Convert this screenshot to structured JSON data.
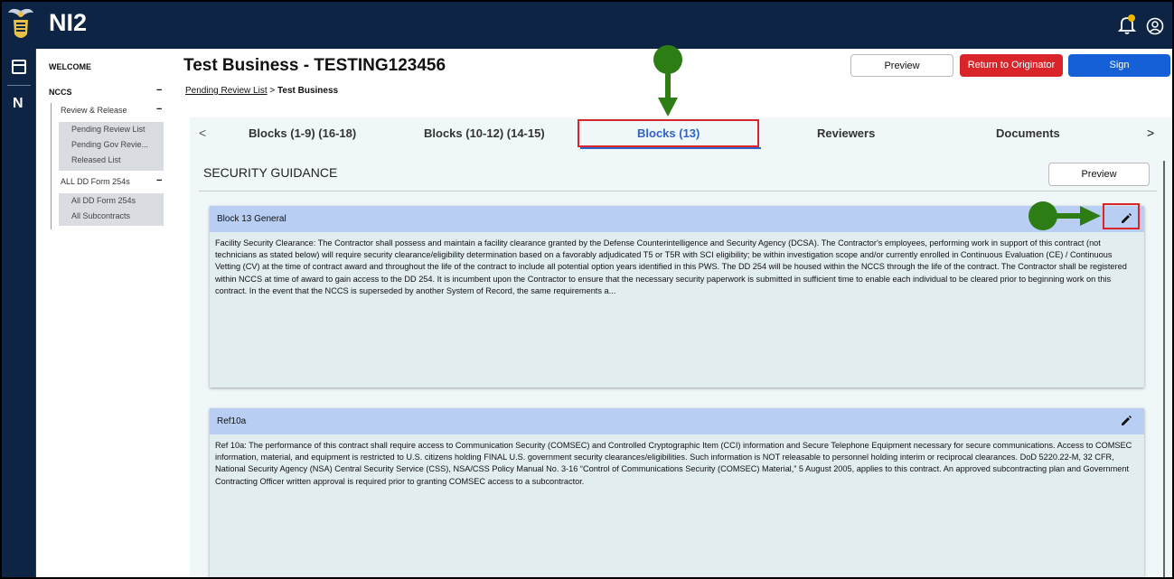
{
  "app": {
    "brand": "NI2"
  },
  "rail": {
    "letter": "N"
  },
  "nav": {
    "welcome": "WELCOME",
    "nccs": "NCCS",
    "review_release": "Review & Release",
    "review_items": [
      "Pending Review List",
      "Pending Gov Revie...",
      "Released List"
    ],
    "all_forms": "ALL DD Form 254s",
    "all_items": [
      "All DD Form 254s",
      "All Subcontracts"
    ]
  },
  "header": {
    "title": "Test Business - TESTING123456",
    "breadcrumb_link": "Pending Review List",
    "breadcrumb_sep": " > ",
    "breadcrumb_current": "Test Business",
    "preview_label": "Preview",
    "return_label": "Return to Originator",
    "sign_label": "Sign"
  },
  "tabs": {
    "items": [
      "Blocks (1-9) (16-18)",
      "Blocks (10-12) (14-15)",
      "Blocks (13)",
      "Reviewers",
      "Documents"
    ],
    "active_index": 2,
    "prev_arrow": "<",
    "next_arrow": ">"
  },
  "section": {
    "title": "SECURITY GUIDANCE",
    "preview_label": "Preview"
  },
  "cards": [
    {
      "title": "Block 13 General",
      "body": "Facility Security Clearance: The Contractor shall possess and maintain a facility clearance granted by the Defense Counterintelligence and Security Agency (DCSA). The Contractor's employees, performing work in support of this contract (not technicians as stated below) will require security clearance/eligibility determination based on a favorably adjudicated T5 or T5R with SCI eligibility; be within investigation scope and/or currently enrolled in Continuous Evaluation (CE) / Continuous Vetting (CV) at the time of contract award and throughout the life of the contract to include all potential option years identified in this PWS. The DD 254 will be housed within the NCCS through the life of the contract. The Contractor shall be registered within NCCS at time of award to gain access to the DD 254. It is incumbent upon the Contractor to ensure that the necessary security paperwork is submitted in sufficient time to enable each individual to be cleared prior to beginning work on this contract. In the event that the NCCS is superseded by another System of Record, the same requirements a..."
    },
    {
      "title": "Ref10a",
      "body": "Ref 10a: The performance of this contract shall require access to Communication Security (COMSEC) and Controlled Cryptographic Item (CCI) information and Secure Telephone Equipment necessary for secure communications. Access to COMSEC information, material, and equipment is restricted to U.S. citizens holding FINAL U.S. government security clearances/eligibilities. Such information is NOT releasable to personnel holding interim or reciprocal clearances. DoD 5220.22-M, 32 CFR, National Security Agency (NSA) Central Security Service (CSS), NSA/CSS Policy Manual No. 3-16 “Control of Communications Security (COMSEC) Material,” 5 August 2005, applies to this contract. An approved subcontracting plan and Government Contracting Officer written approval is required prior to granting COMSEC access to a subcontractor."
    }
  ],
  "colors": {
    "topbar": "#0d2444",
    "accent": "#2f63c7",
    "danger": "#d9252a",
    "primary": "#1560d6",
    "annotation": "#2e7d14",
    "card_header": "#b8cef2"
  },
  "icons": [
    "logo-emblem-icon",
    "bell-icon",
    "user-circle-icon",
    "dashboard-icon",
    "pencil-icon",
    "chevron-left-icon",
    "chevron-right-icon"
  ]
}
